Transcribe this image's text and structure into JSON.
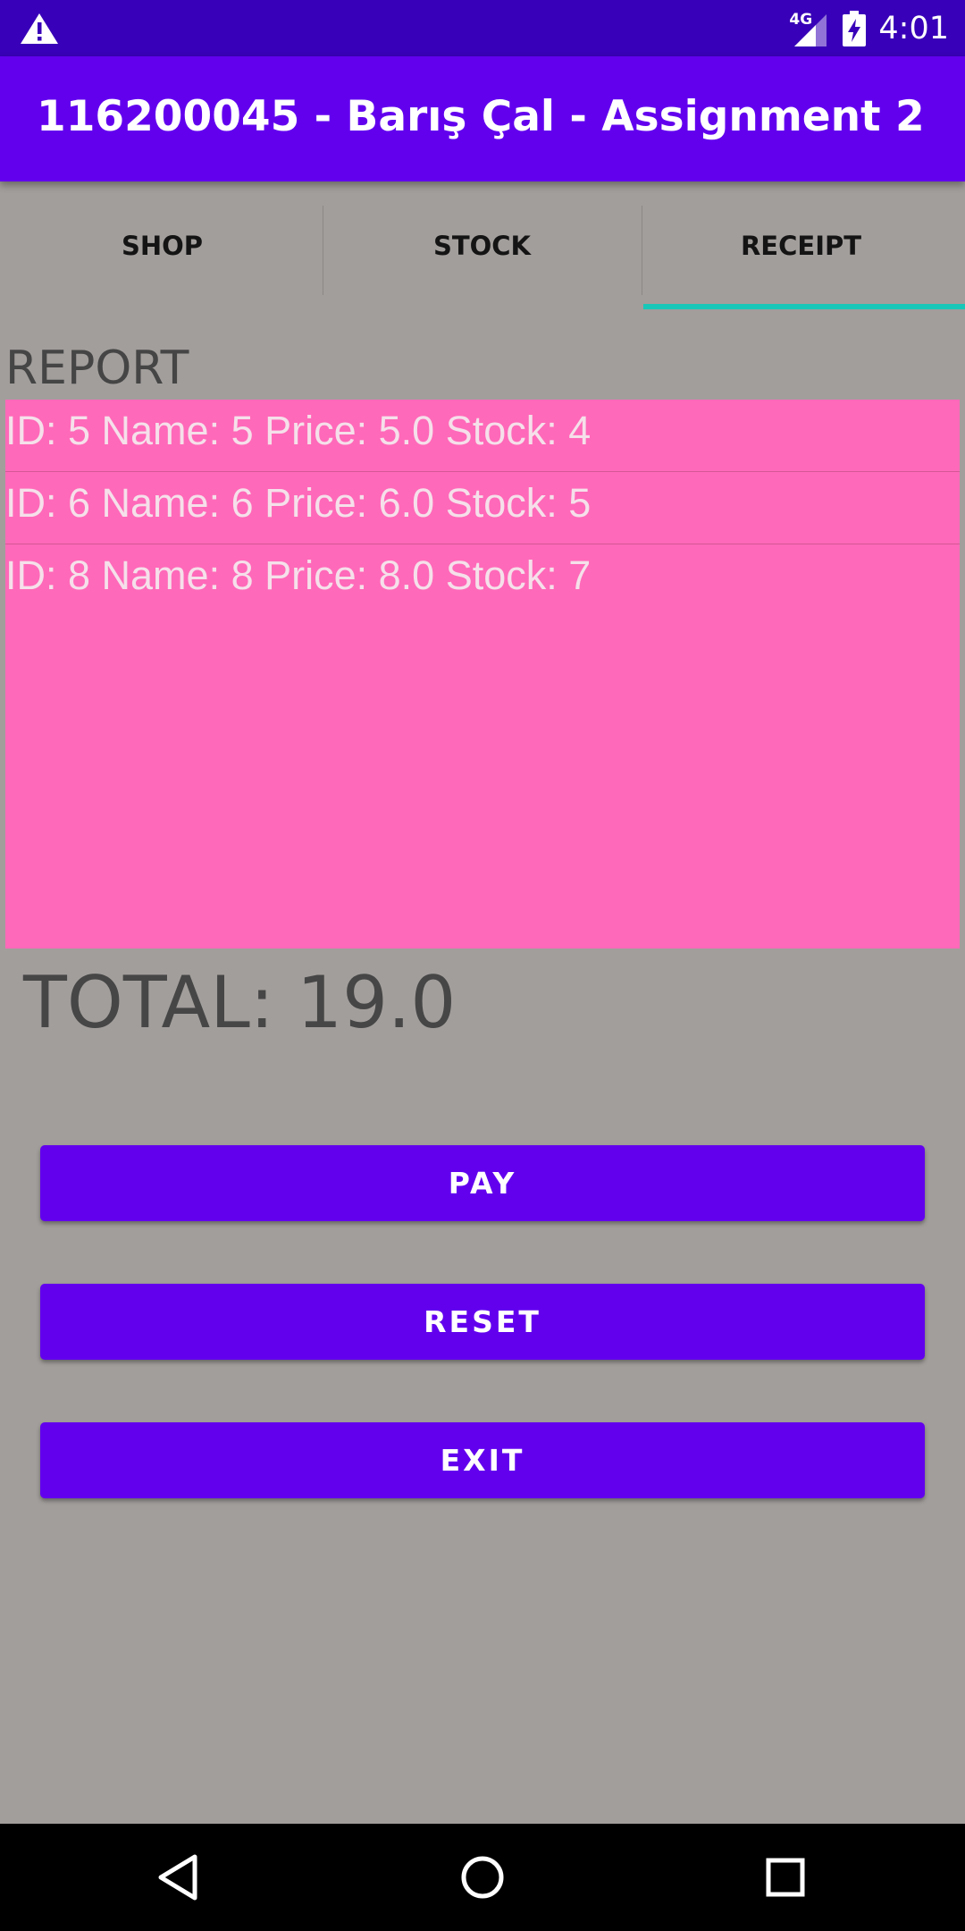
{
  "status_bar": {
    "network": "4G",
    "time": "4:01",
    "icons": [
      "warning-icon",
      "signal-icon",
      "battery-charging-icon"
    ]
  },
  "app_bar": {
    "title": "116200045 - Barış Çal - Assignment 2"
  },
  "tabs": [
    {
      "label": "SHOP",
      "selected": false
    },
    {
      "label": "STOCK",
      "selected": false
    },
    {
      "label": "RECEIPT",
      "selected": true
    }
  ],
  "report": {
    "label": "REPORT",
    "items": [
      "ID: 5 Name: 5 Price: 5.0 Stock: 4",
      "ID: 6 Name: 6 Price: 6.0 Stock: 5",
      "ID: 8 Name: 8 Price: 8.0 Stock: 7"
    ]
  },
  "total": "TOTAL: 19.0",
  "buttons": {
    "pay": "PAY",
    "reset": "RESET",
    "exit": "EXIT"
  },
  "nav_bar": {
    "icons": [
      "back-icon",
      "home-icon",
      "recents-icon"
    ]
  },
  "colors": {
    "status_bar": "#3800b8",
    "app_bar": "#6200ee",
    "background": "#a29e9c",
    "list_background": "#ff69b9",
    "tab_indicator": "#19c7b8",
    "button": "#6200ee"
  }
}
